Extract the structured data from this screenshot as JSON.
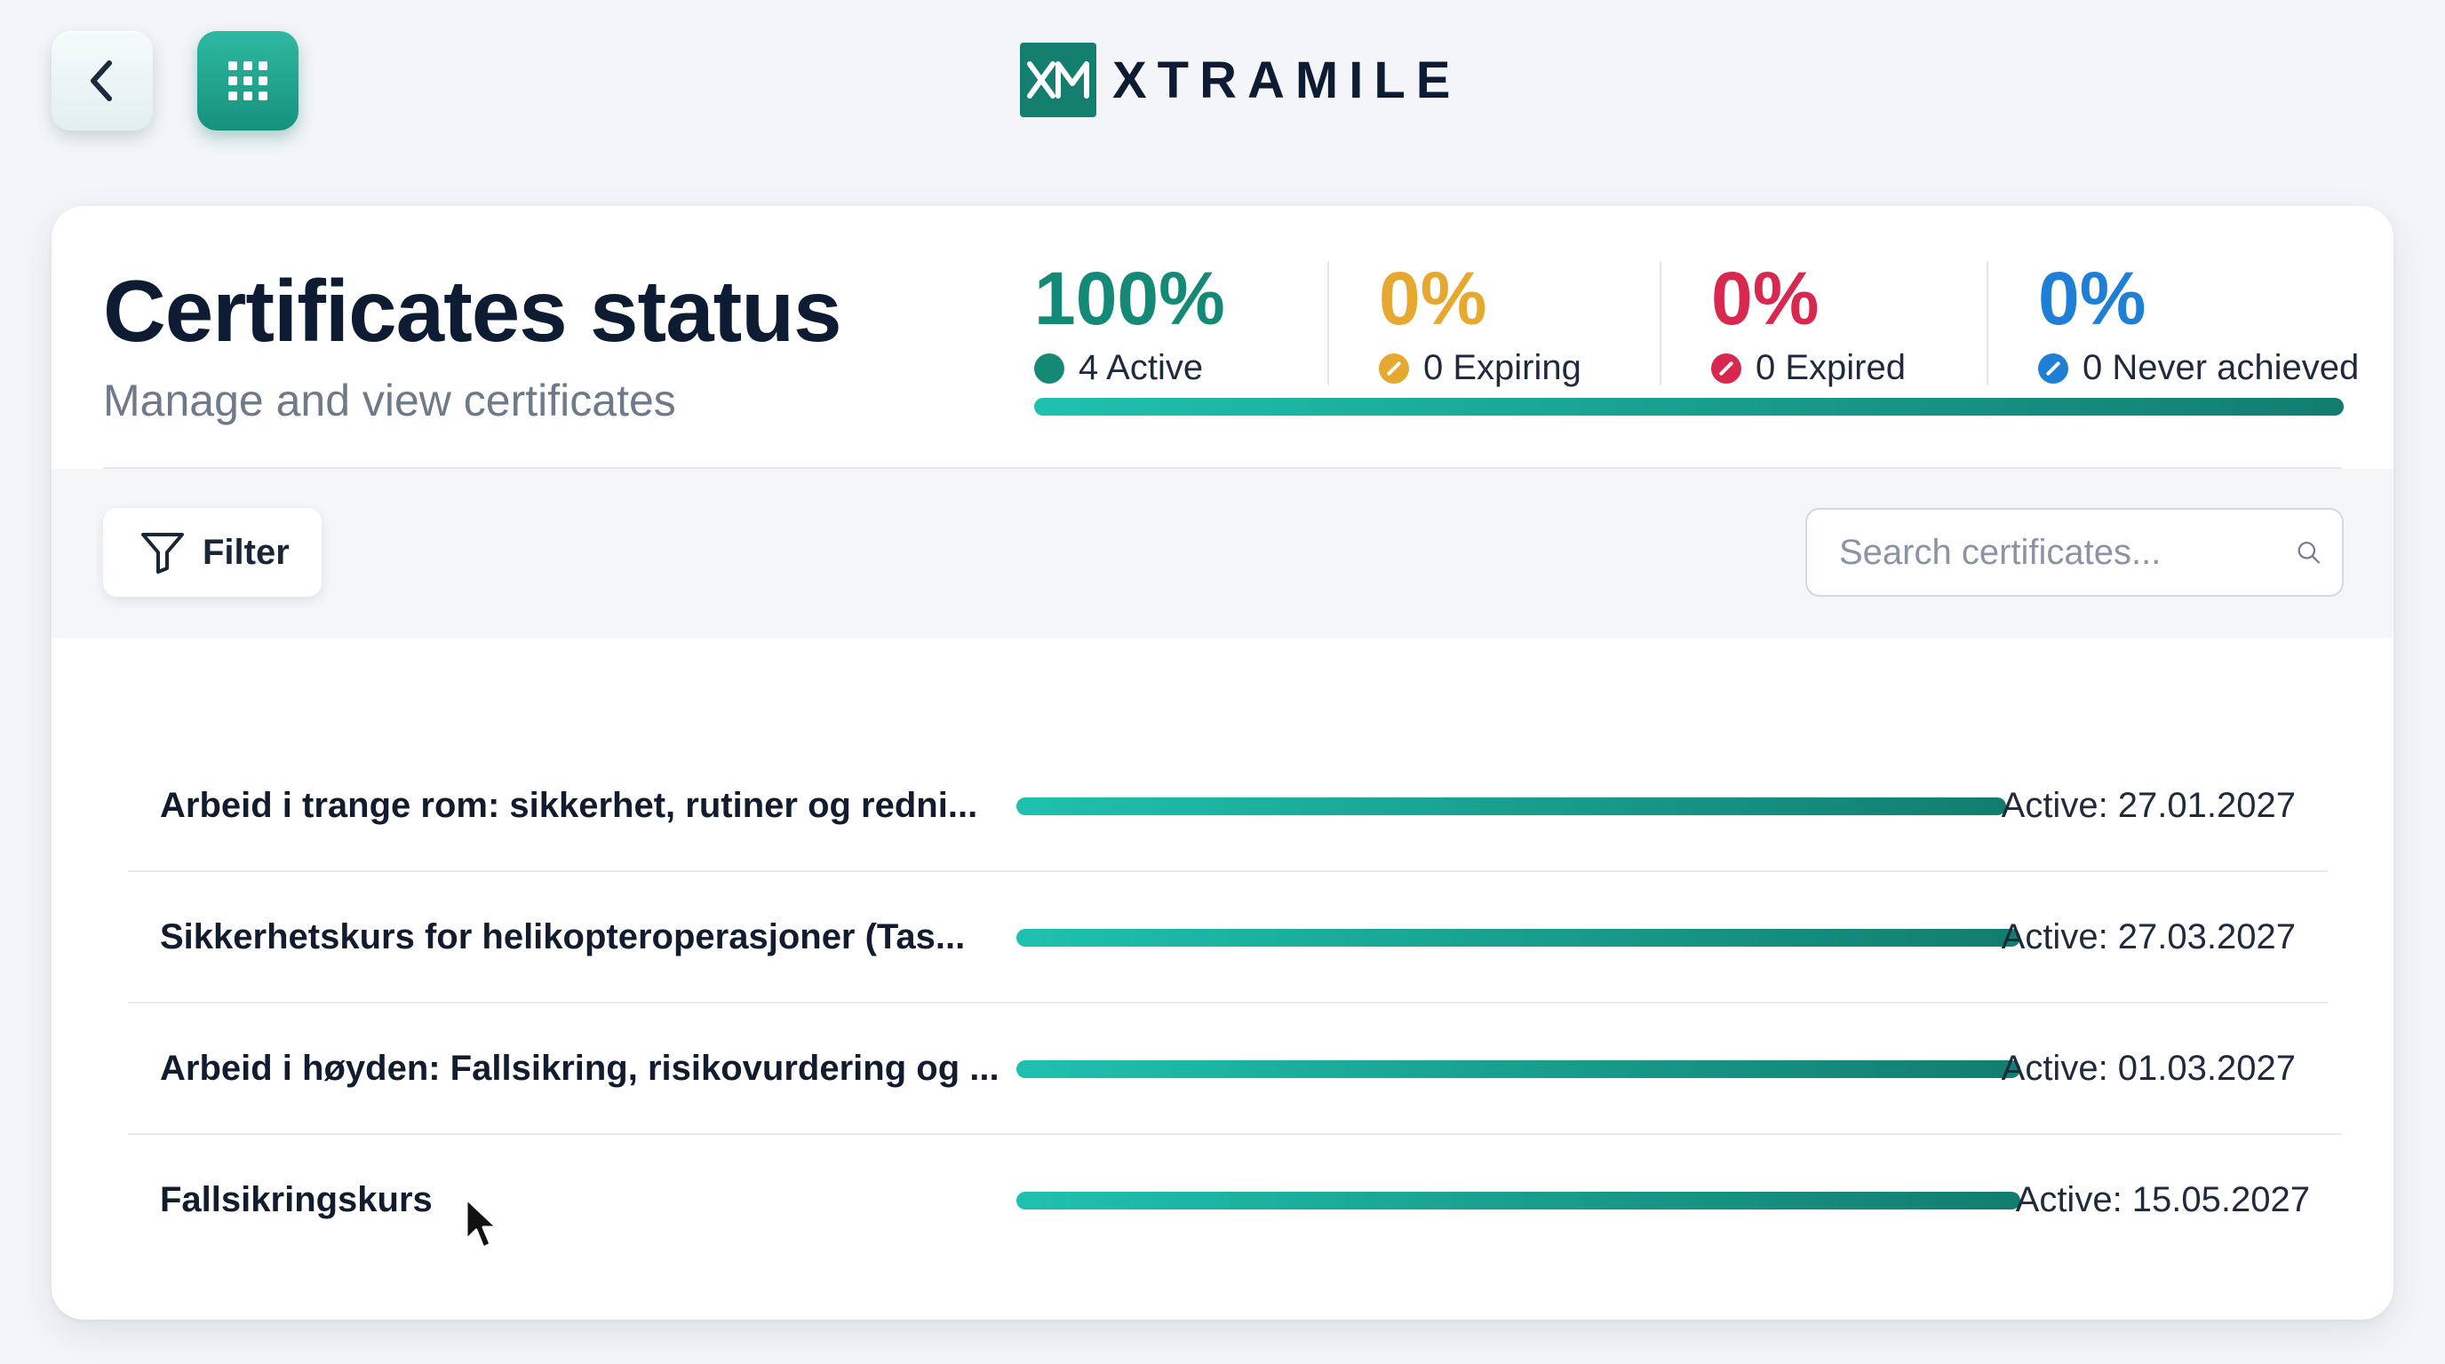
{
  "brand": {
    "mark": "XM",
    "name": "XTRAMILE",
    "color": "#157f6f"
  },
  "nav": {
    "back_icon": "chevron-left-icon",
    "apps_icon": "grid-icon"
  },
  "header": {
    "title": "Certificates status",
    "subtitle": "Manage and view certificates"
  },
  "stats": [
    {
      "percent": "100%",
      "label": "4 Active",
      "color": "#148a76"
    },
    {
      "percent": "0%",
      "label": "0 Expiring",
      "color": "#e6a82e"
    },
    {
      "percent": "0%",
      "label": "0 Expired",
      "color": "#d9284f"
    },
    {
      "percent": "0%",
      "label": "0 Never achieved",
      "color": "#1f7fd6"
    }
  ],
  "summary_progress": {
    "active_fraction": 1.0
  },
  "toolbar": {
    "filter_label": "Filter",
    "search_placeholder": "Search certificates..."
  },
  "certificates": [
    {
      "name": "Arbeid i trange rom: sikkerhet, rutiner og redni...",
      "status": "Active: 27.01.2027",
      "progress": 1.0
    },
    {
      "name": "Sikkerhetskurs for helikopteroperasjoner (Tas...",
      "status": "Active: 27.03.2027",
      "progress": 1.0
    },
    {
      "name": "Arbeid i høyden: Fallsikring, risikovurdering og ...",
      "status": "Active: 01.03.2027",
      "progress": 1.0
    },
    {
      "name": "Fallsikringskurs",
      "status": "Active: 15.05.2027",
      "progress": 1.0
    }
  ],
  "accent_colors": {
    "teal_start": "#1fc1ae",
    "teal_end": "#127d6f"
  }
}
